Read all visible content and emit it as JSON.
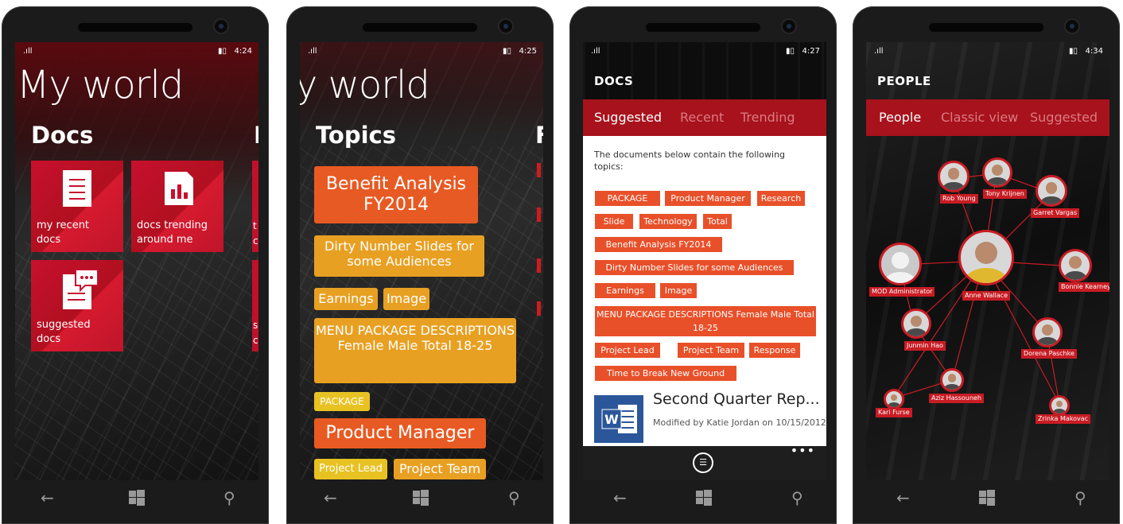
{
  "phones": [
    {
      "status": {
        "time": "4:24"
      },
      "title": "My world",
      "section": "Docs",
      "peek_section": "P",
      "tiles": [
        {
          "label_line1": "my recent",
          "label_line2": "docs",
          "icon": "document-icon"
        },
        {
          "label_line1": "docs trending",
          "label_line2": "around me",
          "icon": "chart-document-icon"
        },
        {
          "label_line1": "suggested",
          "label_line2": "docs",
          "icon": "chat-document-icon"
        }
      ],
      "peek_letters": [
        "t",
        "c",
        "s",
        "c"
      ]
    },
    {
      "status": {
        "time": "4:25"
      },
      "title": "y world",
      "section": "Topics",
      "peek_section": "F",
      "topics": [
        {
          "label": "Benefit Analysis FY2014",
          "color": "red"
        },
        {
          "label": "Dirty Number Slides for some Audiences",
          "color": "amber"
        },
        {
          "label": "Earnings",
          "color": "amber"
        },
        {
          "label": "Image",
          "color": "amber"
        },
        {
          "label": "MENU PACKAGE DESCRIPTIONS Female Male Total 18-25",
          "color": "amber"
        },
        {
          "label": "PACKAGE",
          "color": "yellow"
        },
        {
          "label": "Product Manager",
          "color": "red"
        },
        {
          "label": "Project Lead",
          "color": "yellow"
        },
        {
          "label": "Project Team",
          "color": "amber"
        }
      ]
    },
    {
      "status": {
        "time": "4:27"
      },
      "title": "DOCS",
      "pivots": [
        "Suggested",
        "Recent",
        "Trending"
      ],
      "description": "The documents below contain the following topics:",
      "chips": [
        "PACKAGE",
        "Product Manager",
        "Research",
        "Slide",
        "Technology",
        "Total",
        "Benefit Analysis FY2014",
        "Dirty Number Slides for some Audiences",
        "Earnings",
        "Image",
        "MENU PACKAGE DESCRIPTIONS Female Male Total 18-25",
        "Project Lead",
        "Project Team",
        "Response",
        "Time to Break New Ground"
      ],
      "document": {
        "title": "Second Quarter Rep...",
        "subtitle": "Modified by Katie Jordan on 10/15/2012",
        "app_icon_letter": "W"
      },
      "appbar_more": "•••"
    },
    {
      "status": {
        "time": "4:34"
      },
      "title": "PEOPLE",
      "pivots": [
        "People",
        "Classic view",
        "Suggested"
      ],
      "people": [
        "Rob Young",
        "Tony Krijnen",
        "Garret Vargas",
        "MOD Administrator",
        "Anne Wallace",
        "Bonnie Kearney",
        "Junmin Hao",
        "Dorena Paschke",
        "Aziz Hassouneh",
        "Kari Furse",
        "Zrinka Makovac"
      ]
    }
  ],
  "colors": {
    "accent": "#c81c24",
    "tile": "#c0152a",
    "chip": "#e8502a"
  }
}
